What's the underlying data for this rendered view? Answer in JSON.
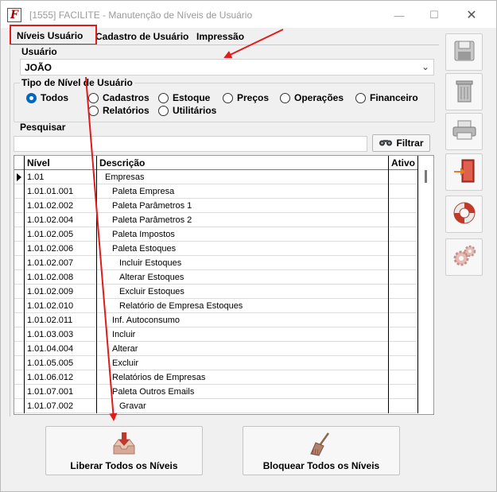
{
  "window": {
    "title": "[1555] FACILITE - Manutenção de Níveis de Usuário",
    "icon_letter": "F",
    "minimize_glyph": "—",
    "maximize_glyph": "☐",
    "close_glyph": "✕"
  },
  "menu": {
    "items": [
      "Níveis Usuário",
      "Cadastro de Usuário",
      "Impressão"
    ]
  },
  "usuario": {
    "label": "Usuário",
    "value": "JOÃO"
  },
  "tipo_nivel": {
    "title": "Tipo de Nível de Usuário",
    "options": [
      "Todos",
      "Cadastros",
      "Estoque",
      "Preços",
      "Operações",
      "Financeiro",
      "Relatórios",
      "Utilitários"
    ],
    "selected": "Todos"
  },
  "search": {
    "label": "Pesquisar",
    "value": "",
    "filter_button": "Filtrar"
  },
  "grid": {
    "columns": [
      "Nível",
      "Descrição",
      "Ativo"
    ],
    "rows": [
      {
        "nivel": "1.01",
        "descricao": "Empresas",
        "indent": 1,
        "ativo": ""
      },
      {
        "nivel": "1.01.01.001",
        "descricao": "Paleta Empresa",
        "indent": 2,
        "ativo": ""
      },
      {
        "nivel": "1.01.02.002",
        "descricao": "Paleta Parâmetros 1",
        "indent": 2,
        "ativo": ""
      },
      {
        "nivel": "1.01.02.004",
        "descricao": "Paleta Parâmetros 2",
        "indent": 2,
        "ativo": ""
      },
      {
        "nivel": "1.01.02.005",
        "descricao": "Paleta Impostos",
        "indent": 2,
        "ativo": ""
      },
      {
        "nivel": "1.01.02.006",
        "descricao": "Paleta Estoques",
        "indent": 2,
        "ativo": ""
      },
      {
        "nivel": "1.01.02.007",
        "descricao": "Incluir Estoques",
        "indent": 3,
        "ativo": ""
      },
      {
        "nivel": "1.01.02.008",
        "descricao": "Alterar Estoques",
        "indent": 3,
        "ativo": ""
      },
      {
        "nivel": "1.01.02.009",
        "descricao": "Excluir Estoques",
        "indent": 3,
        "ativo": ""
      },
      {
        "nivel": "1.01.02.010",
        "descricao": "Relatório de Empresa Estoques",
        "indent": 3,
        "ativo": ""
      },
      {
        "nivel": "1.01.02.011",
        "descricao": "Inf. Autoconsumo",
        "indent": 2,
        "ativo": ""
      },
      {
        "nivel": "1.01.03.003",
        "descricao": "Incluir",
        "indent": 2,
        "ativo": ""
      },
      {
        "nivel": "1.01.04.004",
        "descricao": "Alterar",
        "indent": 2,
        "ativo": ""
      },
      {
        "nivel": "1.01.05.005",
        "descricao": "Excluir",
        "indent": 2,
        "ativo": ""
      },
      {
        "nivel": "1.01.06.012",
        "descricao": "Relatórios de Empresas",
        "indent": 2,
        "ativo": ""
      },
      {
        "nivel": "1.01.07.001",
        "descricao": "Paleta Outros Emails",
        "indent": 2,
        "ativo": ""
      },
      {
        "nivel": "1.01.07.002",
        "descricao": "Gravar",
        "indent": 3,
        "ativo": ""
      }
    ]
  },
  "buttons": {
    "liberar": "Liberar Todos os Níveis",
    "bloquear": "Bloquear Todos os Níveis"
  },
  "side_toolbar": [
    "save-icon",
    "trash-icon",
    "printer-icon",
    "exit-door-icon",
    "help-lifebuoy-icon",
    "settings-gears-icon"
  ],
  "colors": {
    "annotation_red": "#e11b1b",
    "radio_selected": "#0067c0",
    "window_bg": "#f0f0f0"
  }
}
